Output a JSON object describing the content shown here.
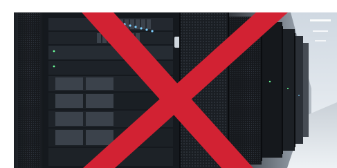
{
  "image": {
    "subject": "server-racks-datacenter-photo",
    "overlay_icon": "cross-x-icon",
    "colors": {
      "overlay": "#d22233",
      "rack_dark": "#111418",
      "aisle_light": "#dfe6ee",
      "led_blue": "#7fd0ff",
      "led_green": "#6bff9a"
    }
  }
}
